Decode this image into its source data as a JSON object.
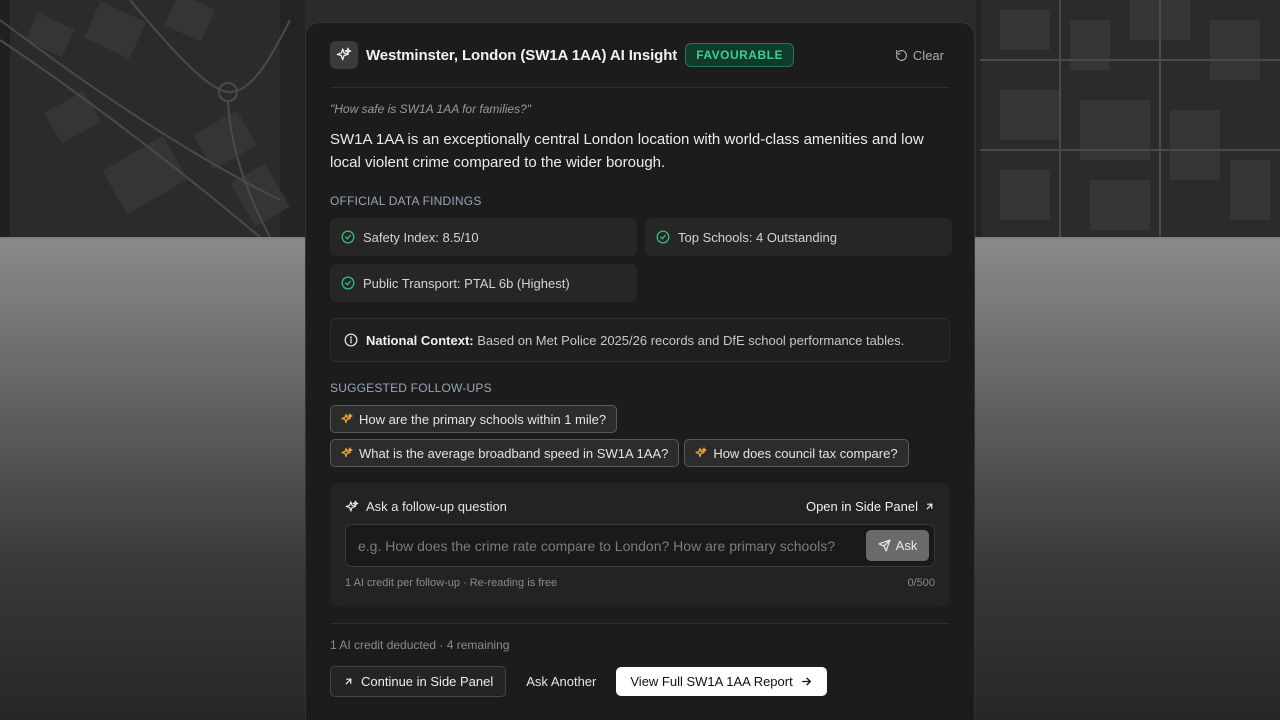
{
  "header": {
    "title": "Westminster, London (SW1A 1AA) AI Insight",
    "status": "FAVOURABLE",
    "clear_label": "Clear"
  },
  "question": "\"How safe is SW1A 1AA for families?\"",
  "answer": "SW1A 1AA is an exceptionally central London location with world-class amenities and low local violent crime compared to the wider borough.",
  "findings": {
    "title": "OFFICIAL DATA FINDINGS",
    "items": [
      "Safety Index: 8.5/10",
      "Top Schools: 4 Outstanding",
      "Public Transport: PTAL 6b (Highest)"
    ]
  },
  "context": {
    "label": "National Context:",
    "text": "Based on Met Police 2025/26 records and DfE school performance tables."
  },
  "followups": {
    "title": "SUGGESTED FOLLOW-UPS",
    "items": [
      "How are the primary schools within 1 mile?",
      "What is the average broadband speed in SW1A 1AA?",
      "How does council tax compare?"
    ]
  },
  "ask": {
    "label": "Ask a follow-up question",
    "side_panel_label": "Open in Side Panel",
    "placeholder": "e.g. How does the crime rate compare to London? How are primary schools?",
    "button_label": "Ask",
    "credit_note": "1 AI credit per follow-up · Re-reading is free",
    "char_count": "0/500"
  },
  "footer": {
    "credit_status": "1 AI credit deducted · 4 remaining",
    "continue_label": "Continue in Side Panel",
    "ask_another_label": "Ask Another",
    "report_label": "View Full SW1A 1AA Report"
  },
  "colors": {
    "accent_green": "#3ccf8e",
    "spark_orange": "#e8a33a",
    "card_bg": "#1c1c1c"
  }
}
